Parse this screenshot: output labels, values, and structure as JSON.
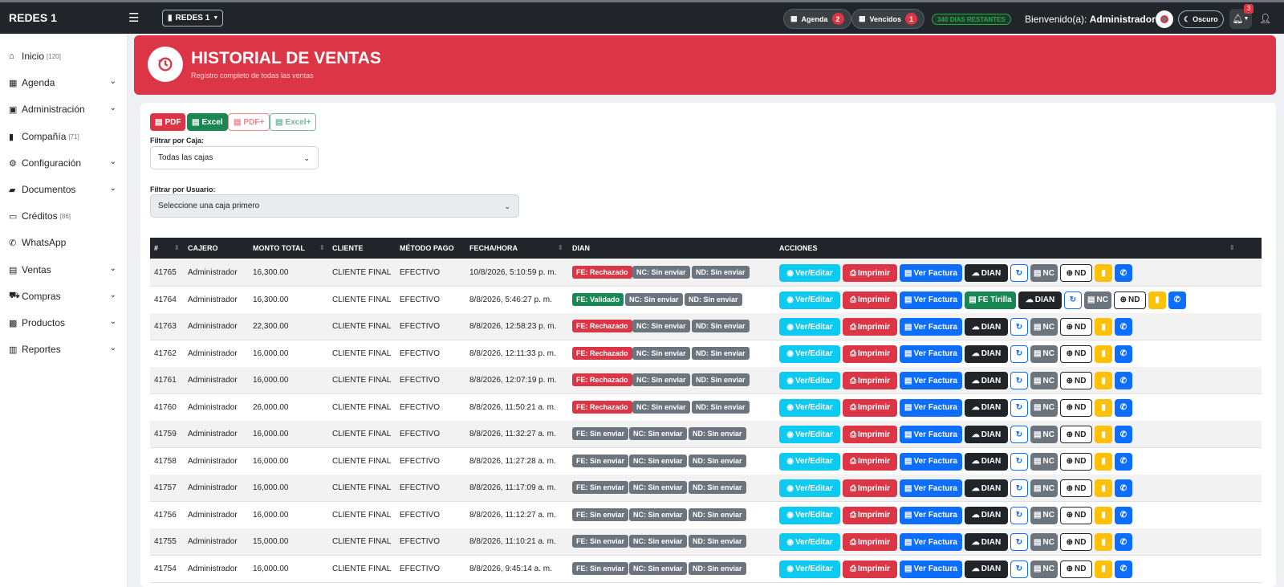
{
  "nav": {
    "brand": "REDES 1",
    "company_dropdown": "REDES 1",
    "agenda_label": "Agenda",
    "agenda_count": "2",
    "vencidos_label": "Vencidos",
    "vencidos_count": "1",
    "days_left": "340 DIAS RESTANTES",
    "welcome_prefix": "Bienvenido(a):",
    "welcome_user": "Administrador",
    "dark_label": "Oscuro",
    "notif_count": "3"
  },
  "sidebar": {
    "items": [
      {
        "label": "Inicio",
        "count": "[120]",
        "icon": "home-icon"
      },
      {
        "label": "Agenda",
        "icon": "calendar-icon",
        "expandable": true
      },
      {
        "label": "Administración",
        "icon": "id-card-icon",
        "expandable": true
      },
      {
        "label": "Compañía",
        "count": "[71]",
        "icon": "building-icon"
      },
      {
        "label": "Configuración",
        "icon": "gears-icon",
        "expandable": true
      },
      {
        "label": "Documentos",
        "icon": "folder-icon",
        "expandable": true
      },
      {
        "label": "Créditos",
        "count": "[86]",
        "icon": "credit-card-icon"
      },
      {
        "label": "WhatsApp",
        "icon": "whatsapp-icon"
      },
      {
        "label": "Ventas",
        "icon": "cash-register-icon",
        "expandable": true
      },
      {
        "label": "Compras",
        "icon": "cart-icon",
        "expandable": true
      },
      {
        "label": "Productos",
        "icon": "boxes-icon",
        "expandable": true
      },
      {
        "label": "Reportes",
        "icon": "chart-icon",
        "expandable": true
      }
    ]
  },
  "header": {
    "title": "HISTORIAL DE VENTAS",
    "subtitle": "Registro completo de todas las ventas"
  },
  "export": {
    "pdf": "PDF",
    "excel": "Excel",
    "pdf_plus": "PDF+",
    "excel_plus": "Excel+"
  },
  "filters": {
    "caja_label": "Filtrar por Caja:",
    "caja_value": "Todas las cajas",
    "usuario_label": "Filtrar por Usuario:",
    "usuario_value": "Seleccione una caja primero"
  },
  "table": {
    "headers": [
      "#",
      "CAJERO",
      "MONTO TOTAL",
      "CLIENTE",
      "MÉTODO PAGO",
      "FECHA/HORA",
      "DIAN",
      "ACCIONES"
    ],
    "rows": [
      {
        "id": "41765",
        "cajero": "Administrador",
        "monto": "16,300.00",
        "cliente": "CLIENTE FINAL",
        "metodo": "EFECTIVO",
        "fecha": "10/8/2026, 5:10:59 p. m.",
        "fe": "FE: Rechazado",
        "nc": "NC: Sin enviar",
        "nd": "ND: Sin enviar"
      },
      {
        "id": "41764",
        "cajero": "Administrador",
        "monto": "16,300.00",
        "cliente": "CLIENTE FINAL",
        "metodo": "EFECTIVO",
        "fecha": "8/8/2026, 5:46:27 p. m.",
        "fe": "FE: Validado",
        "nc": "NC: Sin enviar",
        "nd": "ND: Sin enviar",
        "tirilla": "FE Tirilla"
      },
      {
        "id": "41763",
        "cajero": "Administrador",
        "monto": "22,300.00",
        "cliente": "CLIENTE FINAL",
        "metodo": "EFECTIVO",
        "fecha": "8/8/2026, 12:58:23 p. m.",
        "fe": "FE: Rechazado",
        "nc": "NC: Sin enviar",
        "nd": "ND: Sin enviar"
      },
      {
        "id": "41762",
        "cajero": "Administrador",
        "monto": "16,000.00",
        "cliente": "CLIENTE FINAL",
        "metodo": "EFECTIVO",
        "fecha": "8/8/2026, 12:11:33 p. m.",
        "fe": "FE: Rechazado",
        "nc": "NC: Sin enviar",
        "nd": "ND: Sin enviar"
      },
      {
        "id": "41761",
        "cajero": "Administrador",
        "monto": "16,000.00",
        "cliente": "CLIENTE FINAL",
        "metodo": "EFECTIVO",
        "fecha": "8/8/2026, 12:07:19 p. m.",
        "fe": "FE: Rechazado",
        "nc": "NC: Sin enviar",
        "nd": "ND: Sin enviar"
      },
      {
        "id": "41760",
        "cajero": "Administrador",
        "monto": "26,000.00",
        "cliente": "CLIENTE FINAL",
        "metodo": "EFECTIVO",
        "fecha": "8/8/2026, 11:50:21 a. m.",
        "fe": "FE: Rechazado",
        "nc": "NC: Sin enviar",
        "nd": "ND: Sin enviar"
      },
      {
        "id": "41759",
        "cajero": "Administrador",
        "monto": "16,000.00",
        "cliente": "CLIENTE FINAL",
        "metodo": "EFECTIVO",
        "fecha": "8/8/2026, 11:32:27 a. m.",
        "fe": "FE: Sin enviar",
        "nc": "NC: Sin enviar",
        "nd": "ND: Sin enviar"
      },
      {
        "id": "41758",
        "cajero": "Administrador",
        "monto": "16,000.00",
        "cliente": "CLIENTE FINAL",
        "metodo": "EFECTIVO",
        "fecha": "8/8/2026, 11:27:28 a. m.",
        "fe": "FE: Sin enviar",
        "nc": "NC: Sin enviar",
        "nd": "ND: Sin enviar"
      },
      {
        "id": "41757",
        "cajero": "Administrador",
        "monto": "16,000.00",
        "cliente": "CLIENTE FINAL",
        "metodo": "EFECTIVO",
        "fecha": "8/8/2026, 11:17:09 a. m.",
        "fe": "FE: Sin enviar",
        "nc": "NC: Sin enviar",
        "nd": "ND: Sin enviar"
      },
      {
        "id": "41756",
        "cajero": "Administrador",
        "monto": "16,000.00",
        "cliente": "CLIENTE FINAL",
        "metodo": "EFECTIVO",
        "fecha": "8/8/2026, 11:12:27 a. m.",
        "fe": "FE: Sin enviar",
        "nc": "NC: Sin enviar",
        "nd": "ND: Sin enviar"
      },
      {
        "id": "41755",
        "cajero": "Administrador",
        "monto": "15,000.00",
        "cliente": "CLIENTE FINAL",
        "metodo": "EFECTIVO",
        "fecha": "8/8/2026, 11:10:21 a. m.",
        "fe": "FE: Sin enviar",
        "nc": "NC: Sin enviar",
        "nd": "ND: Sin enviar"
      },
      {
        "id": "41754",
        "cajero": "Administrador",
        "monto": "16,000.00",
        "cliente": "CLIENTE FINAL",
        "metodo": "EFECTIVO",
        "fecha": "8/8/2026, 9:45:14 a. m.",
        "fe": "FE: Sin enviar",
        "nc": "NC: Sin enviar",
        "nd": "ND: Sin enviar"
      }
    ]
  },
  "actions": {
    "ver_editar": "Ver/Editar",
    "imprimir": "Imprimir",
    "ver_factura": "Ver Factura",
    "dian": "DIAN",
    "nc": "NC",
    "nd": "ND"
  },
  "colors": {
    "danger": "#dc3545",
    "success": "#198754",
    "info": "#0dcaf0",
    "primary": "#0d6efd",
    "secondary": "#6c757d",
    "warning": "#ffc107",
    "dark": "#212529"
  }
}
